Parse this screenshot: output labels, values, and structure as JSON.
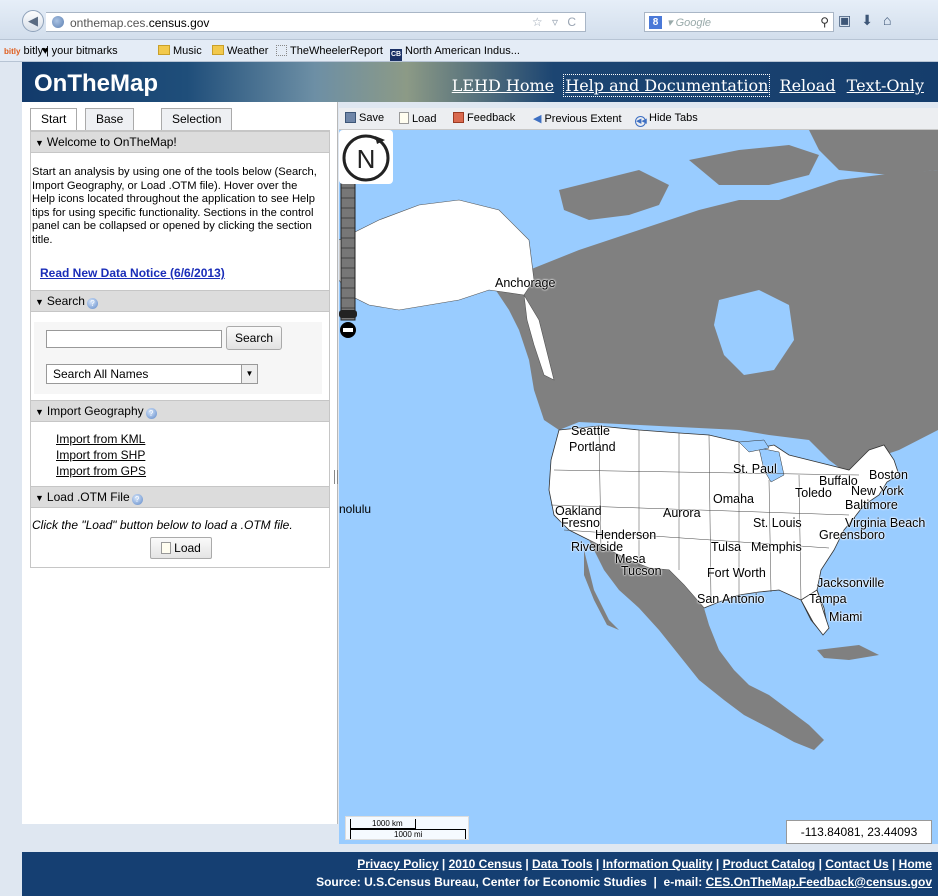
{
  "browser": {
    "url_prefix": "onthemap.ces.",
    "url_domain": "census.gov",
    "search_engine": "Google",
    "bookmarks": [
      "bitly",
      "♥ your bitmarks",
      "Music",
      "Weather",
      "TheWheelerReport",
      "North American Indus..."
    ]
  },
  "header": {
    "title": "OnTheMap",
    "nav": [
      "LEHD Home",
      "Help and Documentation",
      "Reload",
      "Text-Only"
    ]
  },
  "tabs": [
    "Start",
    "Base Map",
    "Selection"
  ],
  "welcome": {
    "title": "Welcome to OnTheMap!",
    "text": "Start an analysis by using one of the tools below (Search, Import Geography, or Load .OTM file). Hover over the Help icons located throughout the application to see Help tips for using specific functionality. Sections in the control panel can be collapsed or opened by clicking the section title.",
    "notice_link": "Read New Data Notice (6/6/2013)"
  },
  "search": {
    "title": "Search",
    "button": "Search",
    "select_value": "Search All Names"
  },
  "import": {
    "title": "Import Geography",
    "links": [
      "Import from KML",
      "Import from SHP",
      "Import from GPS"
    ]
  },
  "load": {
    "title": "Load .OTM File",
    "text": "Click the \"Load\" button below to load a .OTM file.",
    "button": "Load"
  },
  "map_toolbar": {
    "save": "Save",
    "load": "Load",
    "feedback": "Feedback",
    "previous": "Previous Extent",
    "hide_tabs": "Hide Tabs"
  },
  "map": {
    "cities": [
      "Anchorage",
      "Seattle",
      "Portland",
      "St. Paul",
      "Buffalo",
      "Boston",
      "Toledo",
      "New York",
      "Omaha",
      "Baltimore",
      "Oakland",
      "Fresno",
      "Aurora",
      "St. Louis",
      "Virginia Beach",
      "Henderson",
      "Greensboro",
      "Riverside",
      "Tulsa",
      "Memphis",
      "Mesa",
      "Tucson",
      "Fort Worth",
      "Jacksonville",
      "San Antonio",
      "Tampa",
      "Miami"
    ],
    "honolulu": "nolulu",
    "scale_km": "1000 km",
    "scale_mi": "1000 mi",
    "coordinates": "-113.84081, 23.44093"
  },
  "footer": {
    "links": [
      "Privacy Policy",
      "2010 Census",
      "Data Tools",
      "Information Quality",
      "Product Catalog",
      "Contact Us",
      "Home"
    ],
    "source": "Source: U.S.Census Bureau, Center for Economic Studies",
    "email_label": "e-mail:",
    "email": "CES.OnTheMap.Feedback@census.gov"
  }
}
